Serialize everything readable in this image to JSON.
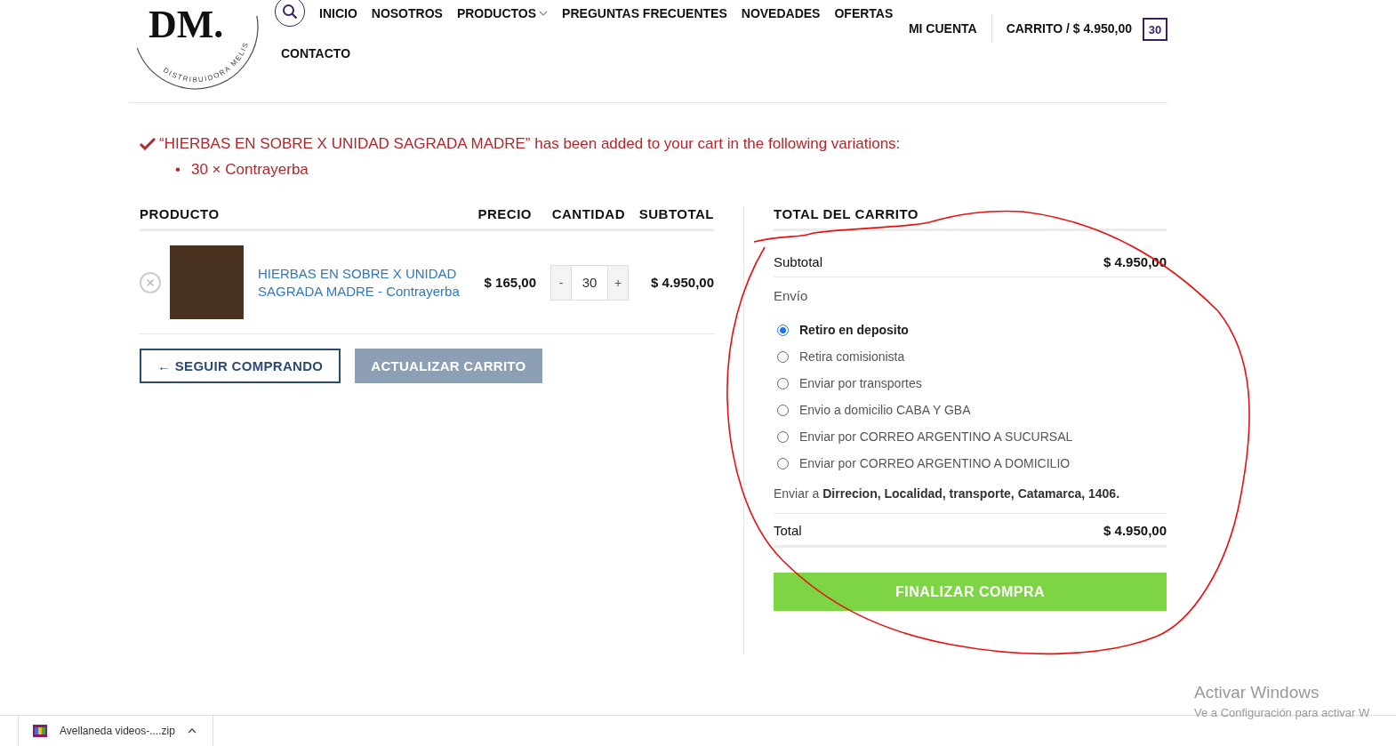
{
  "header": {
    "logo_text": "DM.",
    "logo_subtitle": "DISTRIBUIDORA MELIS",
    "nav": [
      {
        "label": "INICIO",
        "kind": "link"
      },
      {
        "label": "NOSOTROS",
        "kind": "link"
      },
      {
        "label": "PRODUCTOS",
        "kind": "dropdown"
      },
      {
        "label": "PREGUNTAS FRECUENTES",
        "kind": "link"
      },
      {
        "label": "NOVEDADES",
        "kind": "link"
      },
      {
        "label": "OFERTAS",
        "kind": "link"
      }
    ],
    "nav_second_row": [
      {
        "label": "CONTACTO",
        "kind": "link"
      }
    ],
    "account": "MI CUENTA",
    "cart": "CARRITO / $ 4.950,00",
    "cart_count": "30"
  },
  "notice": {
    "message": "“HIERBAS EN SOBRE X UNIDAD SAGRADA MADRE” has been added to your cart in the following variations:",
    "bullet": "•",
    "items": [
      "30 × Contrayerba"
    ]
  },
  "cart_table": {
    "columns": [
      "PRODUCTO",
      "PRECIO",
      "CANTIDAD",
      "SUBTOTAL"
    ],
    "rows": [
      {
        "name": "HIERBAS EN SOBRE X UNIDAD SAGRADA MADRE - Contrayerba",
        "price": "$ 165,00",
        "minus": "-",
        "quantity": "30",
        "plus": "+",
        "subtotal": "$ 4.950,00"
      }
    ]
  },
  "cart_buttons": [
    {
      "label": "← SEGUIR COMPRANDO",
      "kind": "outline",
      "disabled": false
    },
    {
      "label": "ACTUALIZAR CARRITO",
      "kind": "filled",
      "disabled": true
    }
  ],
  "totals": {
    "title": "TOTAL DEL CARRITO",
    "subtotal_label": "Subtotal",
    "subtotal_value": "$ 4.950,00",
    "shipping_label": "Envío",
    "shipping_options": [
      {
        "label": "Retiro en deposito",
        "selected": true
      },
      {
        "label": "Retira comisionista",
        "selected": false
      },
      {
        "label": "Enviar por transportes",
        "selected": false
      },
      {
        "label": "Envio a domicilio CABA Y GBA",
        "selected": false
      },
      {
        "label": "Enviar por CORREO ARGENTINO A SUCURSAL",
        "selected": false
      },
      {
        "label": "Enviar por CORREO ARGENTINO A DOMICILIO",
        "selected": false
      }
    ],
    "ship_to": "Enviar a **Dirrecion, Localidad, transporte, Catamarca, 1406.**",
    "total_label": "Total",
    "total_value": "$ 4.950,00",
    "checkout": "FINALIZAR COMPRA"
  },
  "download_bar": {
    "items": [
      {
        "name": "Avellaneda videos-....zip"
      }
    ]
  },
  "os_watermark": {
    "title": "Activar Windows",
    "subtitle": "Ve a Configuración para activar W"
  }
}
